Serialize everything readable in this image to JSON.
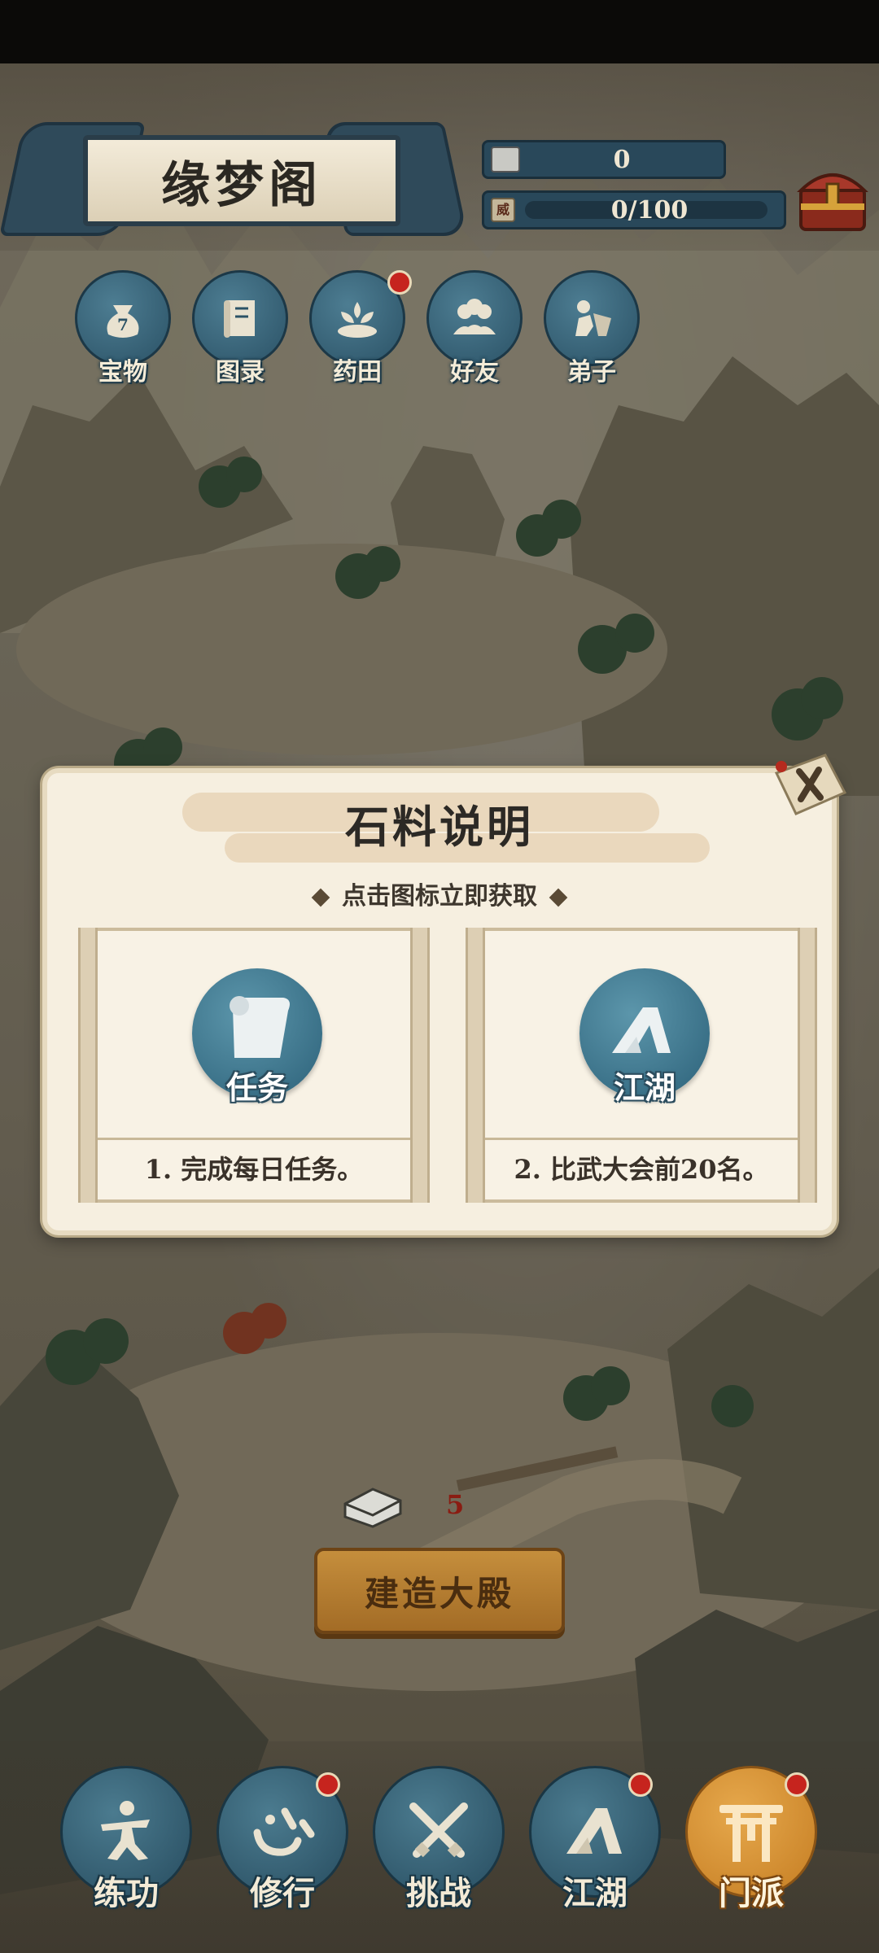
{
  "header": {
    "title": "缘梦阁",
    "stone_count": "0",
    "progress_text": "0/100",
    "progress_badge": "威"
  },
  "top_icons": [
    {
      "label": "宝物",
      "icon": "treasure-bag-icon",
      "badge": false
    },
    {
      "label": "图录",
      "icon": "scroll-book-icon",
      "badge": false
    },
    {
      "label": "药田",
      "icon": "herb-field-icon",
      "badge": true
    },
    {
      "label": "好友",
      "icon": "friends-icon",
      "badge": false
    },
    {
      "label": "弟子",
      "icon": "disciples-icon",
      "badge": false
    }
  ],
  "dialog": {
    "title": "石料说明",
    "subtitle": "点击图标立即获取",
    "cards": [
      {
        "emblem_label": "任务",
        "icon": "scroll-icon",
        "description": "1. 完成每日任务。"
      },
      {
        "emblem_label": "江湖",
        "icon": "mountain-icon",
        "description": "2. 比武大会前20名。"
      }
    ]
  },
  "scene": {
    "stone_required": "5",
    "build_button": "建造大殿"
  },
  "bottom_nav": [
    {
      "label": "练功",
      "icon": "martial-pose-icon",
      "badge": false,
      "active": false
    },
    {
      "label": "修行",
      "icon": "heart-mind-icon",
      "badge": true,
      "active": false
    },
    {
      "label": "挑战",
      "icon": "crossed-swords-icon",
      "badge": false,
      "active": false
    },
    {
      "label": "江湖",
      "icon": "mountain-icon",
      "badge": true,
      "active": false
    },
    {
      "label": "门派",
      "icon": "gate-icon",
      "badge": true,
      "active": true
    }
  ],
  "colors": {
    "icon_blue": "#2b5266",
    "badge_red": "#c6241e",
    "active_orange": "#c57d22",
    "dialog_bg": "#f6efe0"
  }
}
